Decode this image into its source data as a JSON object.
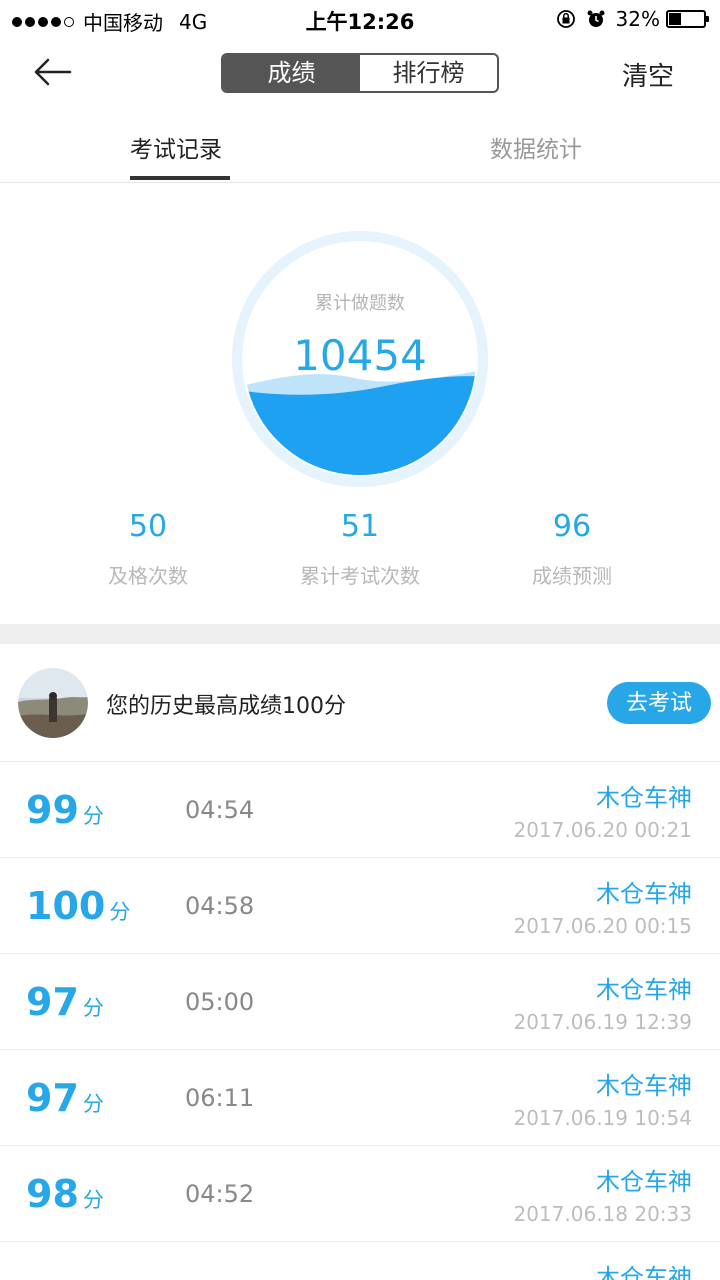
{
  "status_bar": {
    "carrier": "中国移动",
    "network": "4G",
    "time": "上午12:26",
    "battery": "32%",
    "battery_level": 0.32,
    "signal_bars": 4
  },
  "nav": {
    "segments": [
      "成绩",
      "排行榜"
    ],
    "active_segment": "成绩",
    "clear_label": "清空"
  },
  "tabs": [
    {
      "label": "考试记录",
      "active": true
    },
    {
      "label": "数据统计",
      "active": false
    }
  ],
  "summary": {
    "total_label": "累计做题数",
    "total_value": "10454",
    "stats": [
      {
        "value": "50",
        "label": "及格次数"
      },
      {
        "value": "51",
        "label": "累计考试次数"
      },
      {
        "value": "96",
        "label": "成绩预测"
      }
    ]
  },
  "best": {
    "text": "您的历史最高成绩100分",
    "button_label": "去考试"
  },
  "records": [
    {
      "score": "99",
      "unit": "分",
      "duration": "04:54",
      "user": "木仓车神",
      "date": "2017.06.20 00:21"
    },
    {
      "score": "100",
      "unit": "分",
      "duration": "04:58",
      "user": "木仓车神",
      "date": "2017.06.20 00:15"
    },
    {
      "score": "97",
      "unit": "分",
      "duration": "05:00",
      "user": "木仓车神",
      "date": "2017.06.19 12:39"
    },
    {
      "score": "97",
      "unit": "分",
      "duration": "06:11",
      "user": "木仓车神",
      "date": "2017.06.19 10:54"
    },
    {
      "score": "98",
      "unit": "分",
      "duration": "04:52",
      "user": "木仓车神",
      "date": "2017.06.18 20:33"
    },
    {
      "score": "",
      "unit": "",
      "duration": "",
      "user": "木仓车神",
      "date": ""
    }
  ],
  "colors": {
    "accent": "#27a7e7",
    "wave": "#1ea1f0",
    "ring": "#e4f3fc"
  },
  "icons": [
    "back-arrow-icon",
    "orientation-lock-icon",
    "alarm-icon",
    "battery-icon",
    "signal-icon"
  ]
}
